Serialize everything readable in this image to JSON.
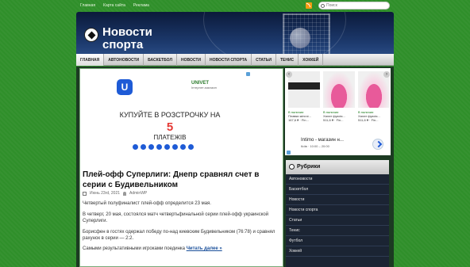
{
  "toplinks": [
    "Главная",
    "Карта сайта",
    "Реклама"
  ],
  "search": {
    "placeholder": "Поиск"
  },
  "header": {
    "title": "Новости спорта"
  },
  "nav": [
    "Главная",
    "Автоновости",
    "Баскетбол",
    "Новости",
    "Новости спорта",
    "Статьи",
    "Тенис",
    "Хоккей"
  ],
  "ad_main": {
    "brand_right": "UNIVET",
    "brand_right_sub": "Інтернет-магазин",
    "line1": "КУПУЙТЕ В РОЗСТРОЧКУ НА",
    "number": "5",
    "line3": "ПЛАТЕЖІВ"
  },
  "post": {
    "title": "Плей-офф Суперлиги: Днепр сравнял счет в серии с Будивельником",
    "date": "Июнь 23rd, 2021",
    "author": "AdminWP",
    "paragraphs": [
      "Четвертый полуфиналист плей-офф определится 23 мая.",
      "В четверг, 20 мая, состоялся матч четвертьфинальной серии плей-офф украинской Суперлиги.",
      "Борисфен в гостях одержал победу по-над киевским Будивельником (76:78) и сравнял рахунок в серии — 2:2."
    ],
    "last_text": "Самыми результативными игроками поединка",
    "readmore": "Читать далее »"
  },
  "ad_side": {
    "products": [
      {
        "stock": "В наличии",
        "name": "Плавки жіночі...",
        "price": "167,6 ₴ · Fin..."
      },
      {
        "stock": "В наличии",
        "name": "Халат фуксія...",
        "price": "511,6 ₴ · Fin..."
      },
      {
        "stock": "В наличии",
        "name": "Халат фуксія...",
        "price": "511,6 ₴ · Fin..."
      }
    ],
    "shop": "Intimo - магазин н...",
    "shop_sub": "Київ · 10:00 – 20:00"
  },
  "widget": {
    "title": "Рубрики",
    "categories": [
      "Автоновости",
      "Баскетбол",
      "Новости",
      "Новости спорта",
      "Статьи",
      "Тенис",
      "Футбол",
      "Хоккей"
    ]
  }
}
